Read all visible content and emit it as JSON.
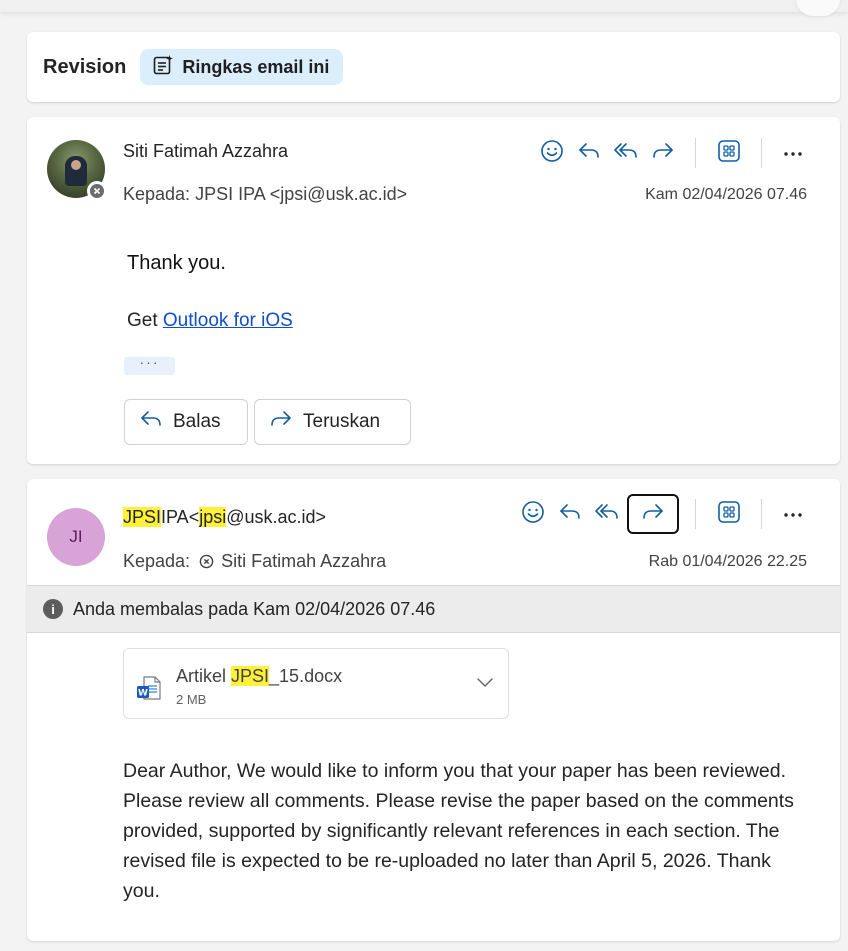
{
  "subject": {
    "title": "Revision",
    "summarize_label": "Ringkas email ini"
  },
  "message1": {
    "sender": "Siti Fatimah Azzahra",
    "to_prefix": "Kepada:",
    "to_value": "JPSI IPA <jpsi@usk.ac.id>",
    "date": "Kam 02/04/2026 07.46",
    "body_line1": "Thank you.",
    "body_get": "Get",
    "body_link": "Outlook for iOS",
    "ellipsis": "···",
    "reply_label": "Balas",
    "forward_label": "Teruskan"
  },
  "message2": {
    "initials": "JI",
    "sender_part1": "JPSI",
    "sender_part2": "IPA<",
    "sender_part3": "jpsi",
    "sender_part4": "@usk.ac.id>",
    "to_prefix": "Kepada:",
    "to_value": "Siti Fatimah Azzahra",
    "date": "Rab 01/04/2026 22.25",
    "info": "Anda membalas pada Kam 02/04/2026 07.46",
    "attachment": {
      "name_part1": "Artikel ",
      "name_part2": "JPSI",
      "name_part3": "_15.docx",
      "size": "2 MB"
    },
    "body": "Dear Author, We would like to inform you that your paper has been reviewed. Please review all comments. Please revise the paper based on the comments provided, supported by significantly relevant references in each section. The revised file is expected to be re-uploaded no later than April 5, 2026. Thank you."
  },
  "colors": {
    "accent": "#115ea3",
    "link": "#0f4ec4",
    "highlight": "#fff03a",
    "initials_bg": "#d8a3d6"
  }
}
